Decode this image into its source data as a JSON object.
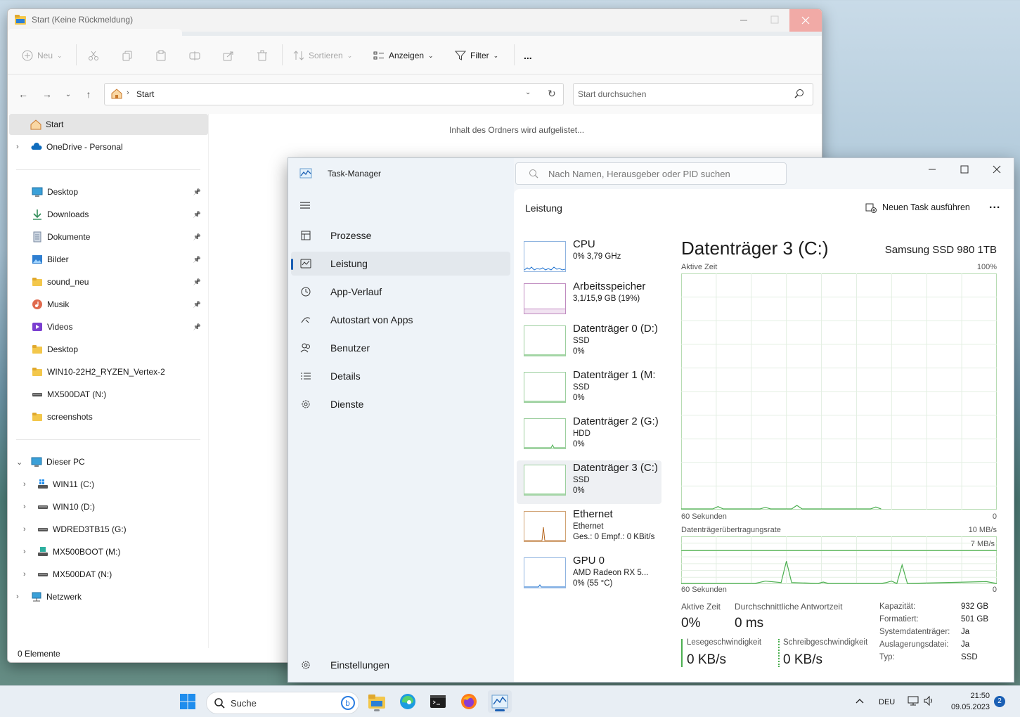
{
  "explorer": {
    "title": "Start (Keine Rückmeldung)",
    "toolbar": {
      "new": "Neu",
      "sort": "Sortieren",
      "view": "Anzeigen",
      "filter": "Filter",
      "more": "..."
    },
    "address": {
      "location": "Start"
    },
    "search_placeholder": "Start durchsuchen",
    "nav": {
      "home": "Start",
      "onedrive": "OneDrive - Personal",
      "quick": [
        {
          "label": "Desktop",
          "icon": "desktop-icon"
        },
        {
          "label": "Downloads",
          "icon": "download-icon"
        },
        {
          "label": "Dokumente",
          "icon": "document-icon"
        },
        {
          "label": "Bilder",
          "icon": "pictures-icon"
        },
        {
          "label": "sound_neu",
          "icon": "folder-icon"
        },
        {
          "label": "Musik",
          "icon": "music-icon"
        },
        {
          "label": "Videos",
          "icon": "video-icon"
        },
        {
          "label": "Desktop",
          "icon": "folder-icon"
        },
        {
          "label": "WIN10-22H2_RYZEN_Vertex-2",
          "icon": "folder-icon"
        },
        {
          "label": "MX500DAT (N:)",
          "icon": "drive-icon"
        },
        {
          "label": "screenshots",
          "icon": "folder-icon"
        }
      ],
      "this_pc": "Dieser PC",
      "drives": [
        "WIN11 (C:)",
        "WIN10 (D:)",
        "WDRED3TB15 (G:)",
        "MX500BOOT (M:)",
        "MX500DAT (N:)"
      ],
      "network": "Netzwerk"
    },
    "content_message": "Inhalt des Ordners wird aufgelistet...",
    "status": "0 Elemente"
  },
  "taskmanager": {
    "title": "Task-Manager",
    "search_placeholder": "Nach Namen, Herausgeber oder PID suchen",
    "nav": [
      {
        "label": "Prozesse",
        "icon": "processes-icon"
      },
      {
        "label": "Leistung",
        "icon": "performance-icon"
      },
      {
        "label": "App-Verlauf",
        "icon": "history-icon"
      },
      {
        "label": "Autostart von Apps",
        "icon": "startup-icon"
      },
      {
        "label": "Benutzer",
        "icon": "users-icon"
      },
      {
        "label": "Details",
        "icon": "details-icon"
      },
      {
        "label": "Dienste",
        "icon": "services-icon"
      }
    ],
    "settings": "Einstellungen",
    "page_title": "Leistung",
    "run_task": "Neuen Task ausführen",
    "more": "...",
    "perf_items": [
      {
        "name": "CPU",
        "sub1": "0% 3,79 GHz",
        "sub2": ""
      },
      {
        "name": "Arbeitsspeicher",
        "sub1": "3,1/15,9 GB (19%)",
        "sub2": ""
      },
      {
        "name": "Datenträger 0 (D:)",
        "sub1": "SSD",
        "sub2": "0%"
      },
      {
        "name": "Datenträger 1 (M:",
        "sub1": "SSD",
        "sub2": "0%"
      },
      {
        "name": "Datenträger 2 (G:)",
        "sub1": "HDD",
        "sub2": "0%"
      },
      {
        "name": "Datenträger 3 (C:)",
        "sub1": "SSD",
        "sub2": "0%"
      },
      {
        "name": "Ethernet",
        "sub1": "Ethernet",
        "sub2": "Ges.: 0 Empf.: 0 KBit/s"
      },
      {
        "name": "GPU 0",
        "sub1": "AMD Radeon RX 5...",
        "sub2": "0% (55 °C)"
      }
    ],
    "detail": {
      "title": "Datenträger 3 (C:)",
      "model": "Samsung SSD 980 1TB",
      "chart1_label": "Aktive Zeit",
      "chart1_max": "100%",
      "chart1_xlabel": "60 Sekunden",
      "chart1_min": "0",
      "chart2_label": "Datenträgerübertragungsrate",
      "chart2_max": "10 MB/s",
      "chart2_line": "7 MB/s",
      "chart2_xlabel": "60 Sekunden",
      "chart2_min": "0",
      "active_time_label": "Aktive Zeit",
      "active_time_value": "0%",
      "response_label": "Durchschnittliche Antwortzeit",
      "response_value": "0 ms",
      "read_label": "Lesegeschwindigkeit",
      "read_value": "0 KB/s",
      "write_label": "Schreibgeschwindigkeit",
      "write_value": "0 KB/s",
      "props": [
        {
          "k": "Kapazität:",
          "v": "932 GB"
        },
        {
          "k": "Formatiert:",
          "v": "501 GB"
        },
        {
          "k": "Systemdatenträger:",
          "v": "Ja"
        },
        {
          "k": "Auslagerungsdatei:",
          "v": "Ja"
        },
        {
          "k": "Typ:",
          "v": "SSD"
        }
      ]
    }
  },
  "taskbar": {
    "search": "Suche",
    "lang": "DEU",
    "time": "21:50",
    "date": "09.05.2023",
    "notif_count": "2"
  },
  "chart_data": [
    {
      "type": "line",
      "title": "Aktive Zeit",
      "ylim": [
        0,
        100
      ],
      "xlabel": "60 Sekunden",
      "x": [
        0,
        6,
        7,
        8,
        15,
        16,
        17,
        21,
        22,
        23,
        36,
        37,
        38
      ],
      "y": [
        0,
        0,
        1,
        0,
        0,
        0.7,
        0,
        0,
        1.5,
        0,
        0,
        0.8,
        0
      ]
    },
    {
      "type": "line",
      "title": "Datenträgerübertragungsrate",
      "ylim": [
        0,
        10
      ],
      "xlabel": "60 Sekunden",
      "x": [
        0,
        14,
        16,
        19,
        20,
        21,
        26,
        27,
        28,
        38,
        39,
        40,
        41,
        42,
        43,
        58,
        60
      ],
      "y": [
        0,
        0,
        0.5,
        0.2,
        4.8,
        0.2,
        0,
        0.3,
        0,
        0,
        0.2,
        0.5,
        0,
        4,
        0,
        0.4,
        0
      ]
    }
  ]
}
